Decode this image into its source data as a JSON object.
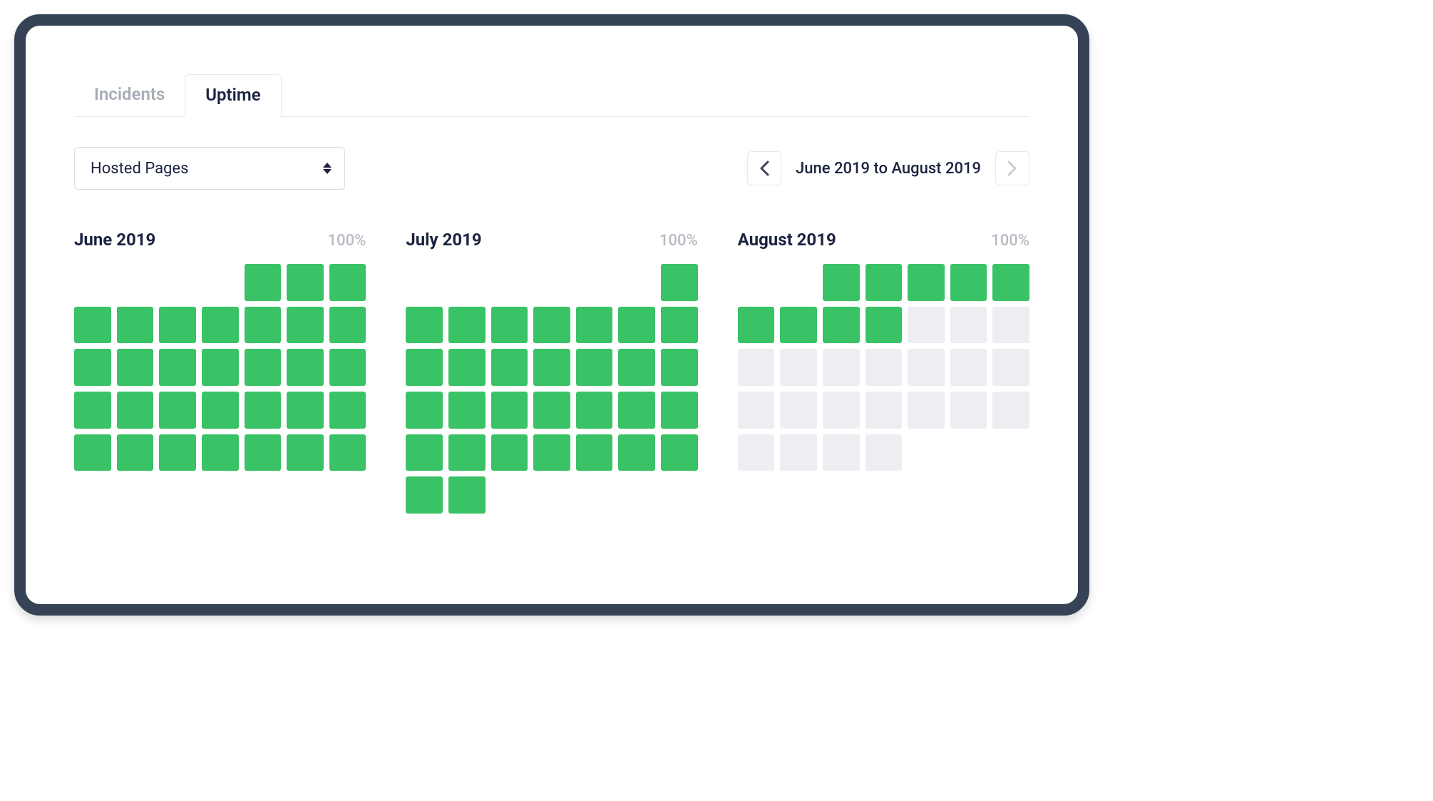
{
  "tabs": [
    {
      "label": "Incidents",
      "active": false
    },
    {
      "label": "Uptime",
      "active": true
    }
  ],
  "select": {
    "value": "Hosted Pages"
  },
  "range": {
    "label": "June 2019 to August 2019"
  },
  "colors": {
    "green": "#39c366",
    "grey": "#eceef1"
  },
  "months": [
    {
      "title": "June 2019",
      "pct": "100%",
      "leading_empty": 4,
      "days": [
        "g",
        "g",
        "g",
        "g",
        "g",
        "g",
        "g",
        "g",
        "g",
        "g",
        "g",
        "g",
        "g",
        "g",
        "g",
        "g",
        "g",
        "g",
        "g",
        "g",
        "g",
        "g",
        "g",
        "g",
        "g",
        "g",
        "g",
        "g",
        "g",
        "g",
        "g"
      ]
    },
    {
      "title": "July 2019",
      "pct": "100%",
      "leading_empty": 6,
      "days": [
        "g",
        "g",
        "g",
        "g",
        "g",
        "g",
        "g",
        "g",
        "g",
        "g",
        "g",
        "g",
        "g",
        "g",
        "g",
        "g",
        "g",
        "g",
        "g",
        "g",
        "g",
        "g",
        "g",
        "g",
        "g",
        "g",
        "g",
        "g",
        "g",
        "g",
        "g"
      ]
    },
    {
      "title": "August 2019",
      "pct": "100%",
      "leading_empty": 2,
      "days": [
        "g",
        "g",
        "g",
        "g",
        "g",
        "g",
        "g",
        "g",
        "g",
        "e",
        "e",
        "e",
        "e",
        "e",
        "e",
        "e",
        "e",
        "e",
        "e",
        "e",
        "e",
        "e",
        "e",
        "e",
        "e",
        "e",
        "e",
        "e",
        "e",
        "e"
      ]
    }
  ]
}
